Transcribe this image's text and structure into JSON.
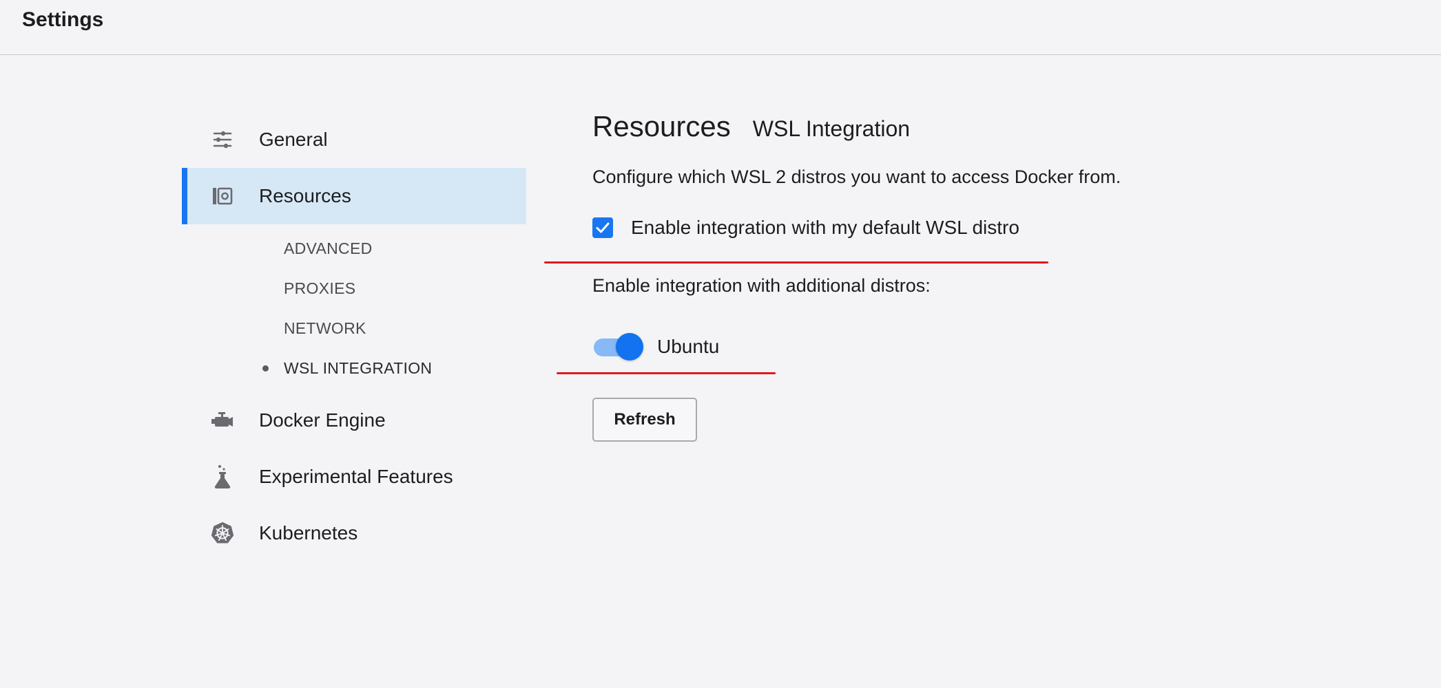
{
  "header": {
    "title": "Settings"
  },
  "sidebar": {
    "items": [
      {
        "label": "General",
        "icon": "sliders-icon"
      },
      {
        "label": "Resources",
        "icon": "resources-icon",
        "active": true
      },
      {
        "label": "Docker Engine",
        "icon": "engine-icon"
      },
      {
        "label": "Experimental Features",
        "icon": "flask-icon"
      },
      {
        "label": "Kubernetes",
        "icon": "kubernetes-icon"
      }
    ],
    "sub_items": [
      {
        "label": "ADVANCED"
      },
      {
        "label": "PROXIES"
      },
      {
        "label": "NETWORK"
      },
      {
        "label": "WSL INTEGRATION",
        "current": true
      }
    ]
  },
  "main": {
    "title": "Resources",
    "subtitle": "WSL Integration",
    "description": "Configure which WSL 2 distros you want to access Docker from.",
    "default_distro_checkbox": {
      "label": "Enable integration with my default WSL distro",
      "checked": true
    },
    "additional_label": "Enable integration with additional distros:",
    "distros": [
      {
        "label": "Ubuntu",
        "enabled": true
      }
    ],
    "refresh_label": "Refresh"
  },
  "colors": {
    "accent": "#1976f0",
    "active_bg": "#d6e8f6",
    "annotation_red": "#e0181c",
    "background": "#f4f4f6"
  }
}
